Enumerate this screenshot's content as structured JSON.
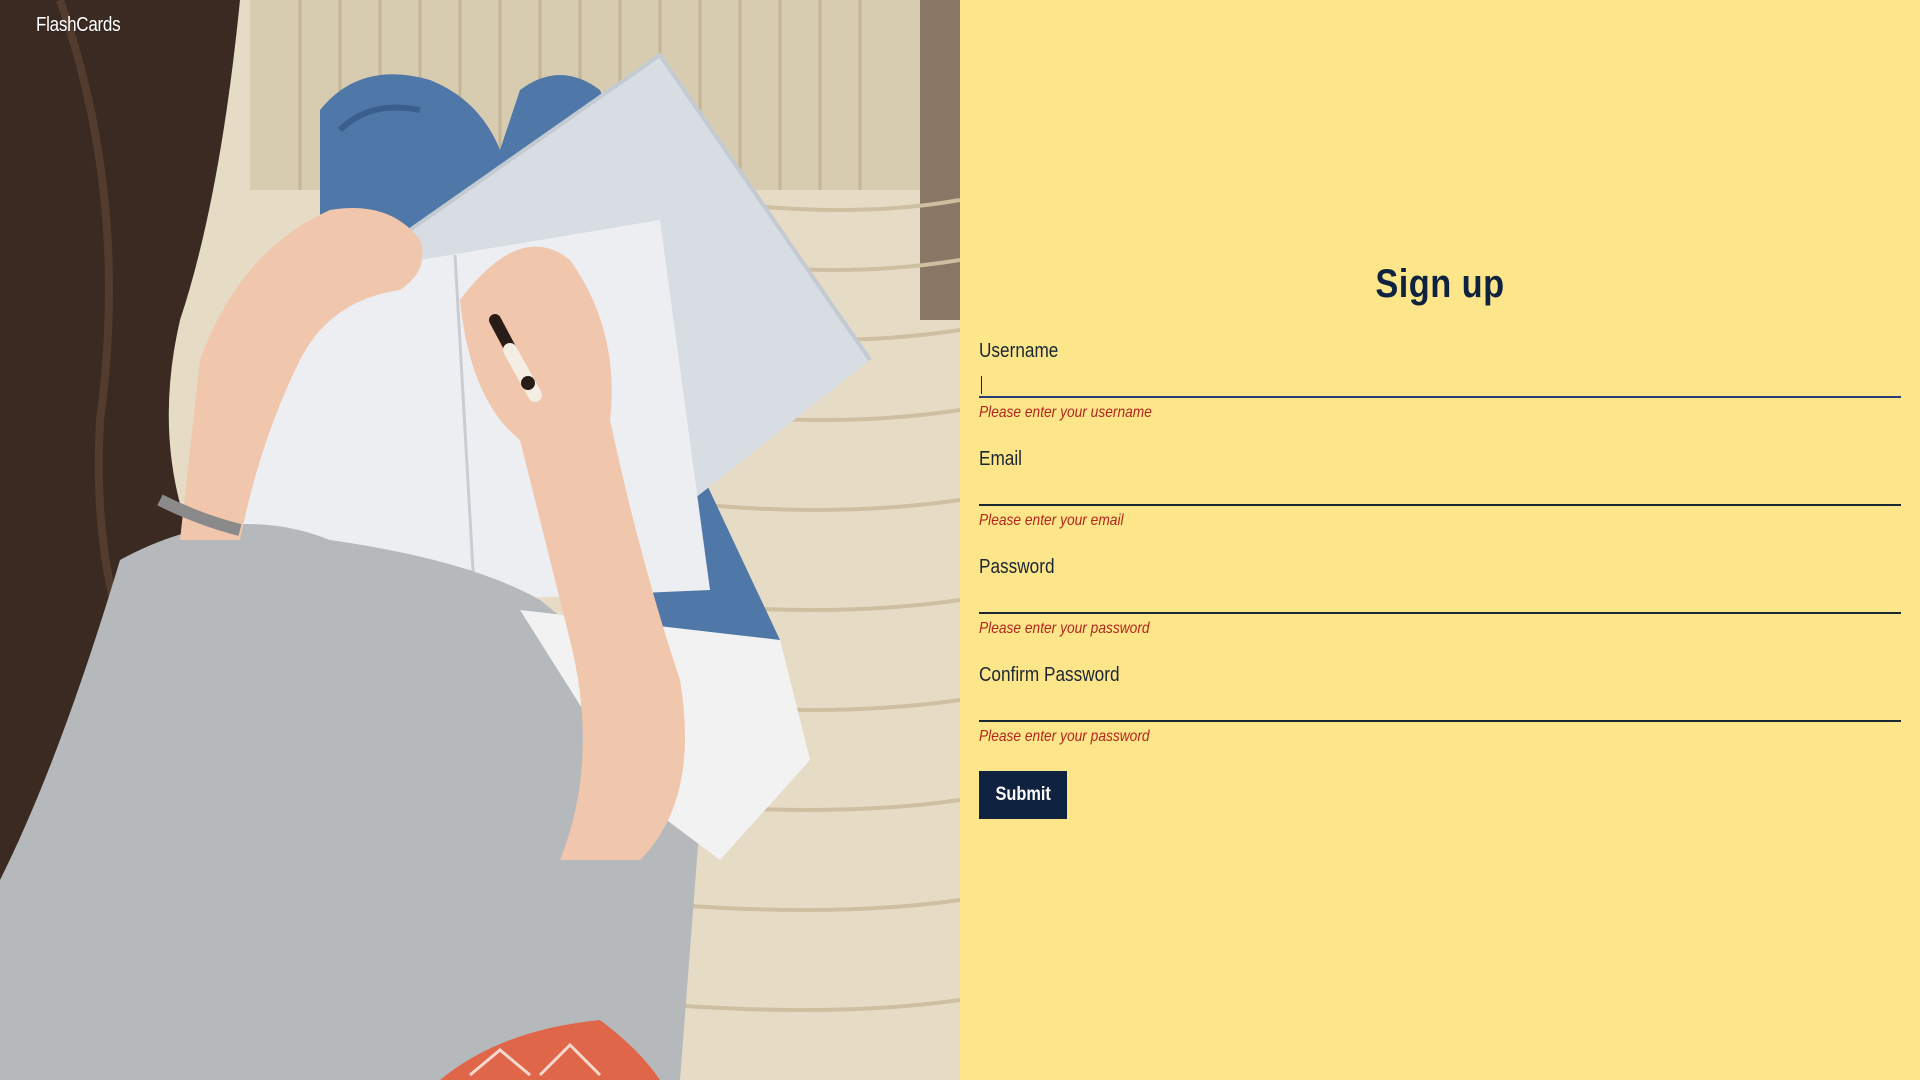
{
  "app": {
    "brand": "FlashCards"
  },
  "form": {
    "title": "Sign up",
    "fields": [
      {
        "label": "Username",
        "value": "",
        "error": "Please enter your username",
        "focused": true
      },
      {
        "label": "Email",
        "value": "",
        "error": "Please enter your email",
        "focused": false
      },
      {
        "label": "Password",
        "value": "",
        "error": "Please enter your password",
        "focused": false
      },
      {
        "label": "Confirm Password",
        "value": "",
        "error": "Please enter your password",
        "focused": false
      }
    ],
    "submit_label": "Submit"
  },
  "colors": {
    "panel_background": "#fde68a",
    "primary": "#0f2340",
    "error": "#b3261e"
  }
}
